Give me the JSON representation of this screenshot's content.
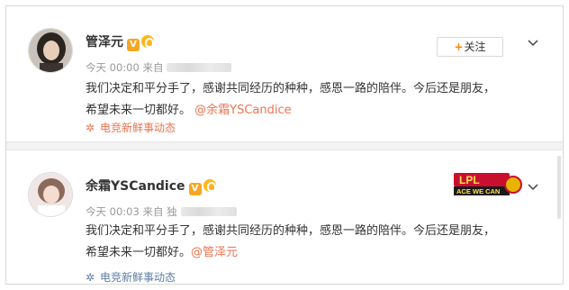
{
  "posts": [
    {
      "username": "管泽元",
      "vip_badge": "V",
      "time": "今天 00:00",
      "source_prefix": "来自",
      "content_line1": "我们决定和平分手了，感谢共同经历的种种，感恩一路的陪伴。今后还是朋友，",
      "content_line2": "希望未来一切都好。",
      "mention": "@余霜YSCandice",
      "tag": "电竞新鲜事动态",
      "follow_label": "关注",
      "follow_plus": "+"
    },
    {
      "username": "余霜YSCandice",
      "vip_badge": "V",
      "time": "今天 00:03",
      "source_prefix": "来自 独",
      "content_line1": "我们决定和平分手了，感谢共同经历的种种，感恩一路的陪伴。今后还是朋友，",
      "content_line2": "希望未来一切都好。",
      "mention": "@管泽元",
      "tag": "电竞新鲜事动态",
      "overlay_logo_top": "LPL",
      "overlay_logo_bottom": "ACE WE CAN"
    }
  ],
  "colors": {
    "accent": "#eb7350",
    "tag1": "#eb7350",
    "tag2": "#5d7ea1",
    "follow_plus": "#ff8200",
    "vip": "#f5a623"
  },
  "icons": {
    "chevron": "chevron-down-icon",
    "tag1": "sparkle-icon",
    "tag2": "sparkle-icon"
  }
}
